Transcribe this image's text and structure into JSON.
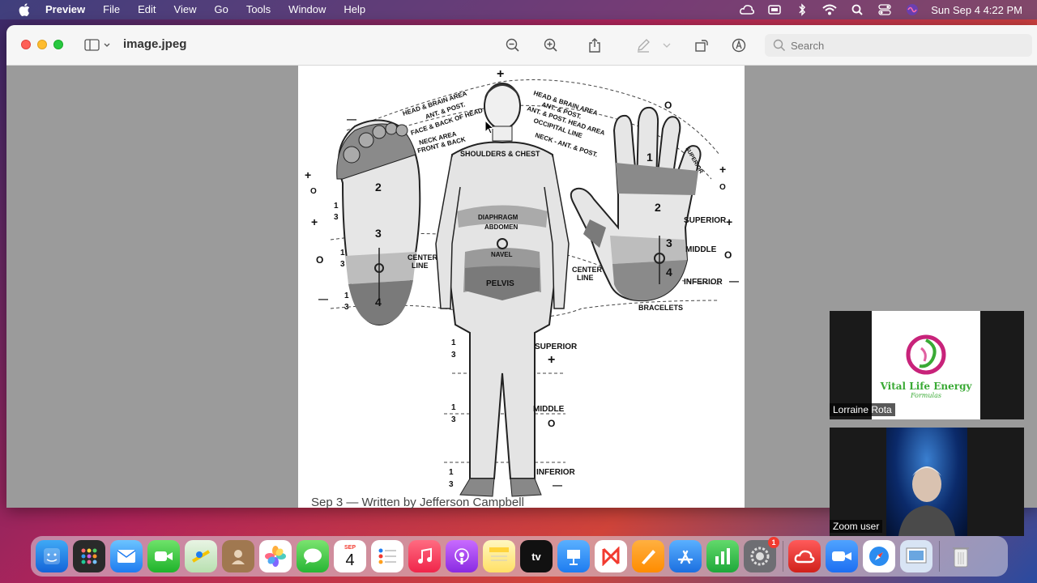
{
  "menubar": {
    "app_name": "Preview",
    "menus": [
      "File",
      "Edit",
      "View",
      "Go",
      "Tools",
      "Window",
      "Help"
    ],
    "clock": "Sun Sep 4  4:22 PM"
  },
  "window": {
    "title": "image.jpeg",
    "search_placeholder": "Search"
  },
  "diagram": {
    "labels": {
      "head_left_1": "HEAD & BRAIN AREA",
      "head_left_2": "ANT. & POST.",
      "head_left_3": "FACE & BACK OF HEAD",
      "head_left_4": "NECK AREA",
      "head_left_5": "FRONT & BACK",
      "head_right_1": "HEAD & BRAIN AREA",
      "head_right_2": "ANT. & POST.",
      "head_right_3": "ANT. & POST. HEAD AREA",
      "head_right_4": "OCCIPITAL LINE",
      "head_right_5": "NECK - ANT. & POST.",
      "shoulders": "SHOULDERS & CHEST",
      "diaphragm": "DIAPHRAGM",
      "abdomen": "ABDOMEN",
      "navel": "NAVEL",
      "pelvis": "PELVIS",
      "center_line_left": "CENTER LINE",
      "center_line_right": "CENTER LINE",
      "superior_hand": "SUPERIOR",
      "middle_hand": "MIDDLE",
      "inferior_hand": "INFERIOR",
      "bracelets": "BRACELETS",
      "superior_leg": "SUPERIOR",
      "middle_leg": "MIDDLE",
      "inferior_leg": "INFERIOR",
      "superior_finger": "SUPERIOR",
      "middle_finger": "MIDDLE",
      "inferior_finger": "INFERIOR"
    },
    "numbers": {
      "foot_2": "2",
      "foot_3": "3",
      "foot_4": "4",
      "hand_1": "1",
      "hand_2": "2",
      "hand_3": "3",
      "hand_4": "4"
    },
    "fractions": {
      "numerator": "1",
      "denominator": "3"
    },
    "signs": {
      "plus": "+",
      "minus": "—",
      "zero": "O"
    }
  },
  "behind": {
    "caption": "Sep 3 — Written by Jefferson Campbell"
  },
  "zoom": {
    "tile1_name": "Lorraine Rota",
    "tile1_logo_name": "Vital Life Energy",
    "tile1_logo_sub": "Formulas",
    "tile2_name": "Zoom user"
  },
  "dock": {
    "calendar_month": "SEP",
    "calendar_day": "4",
    "settings_badge": "1",
    "tv_label": "tv"
  }
}
